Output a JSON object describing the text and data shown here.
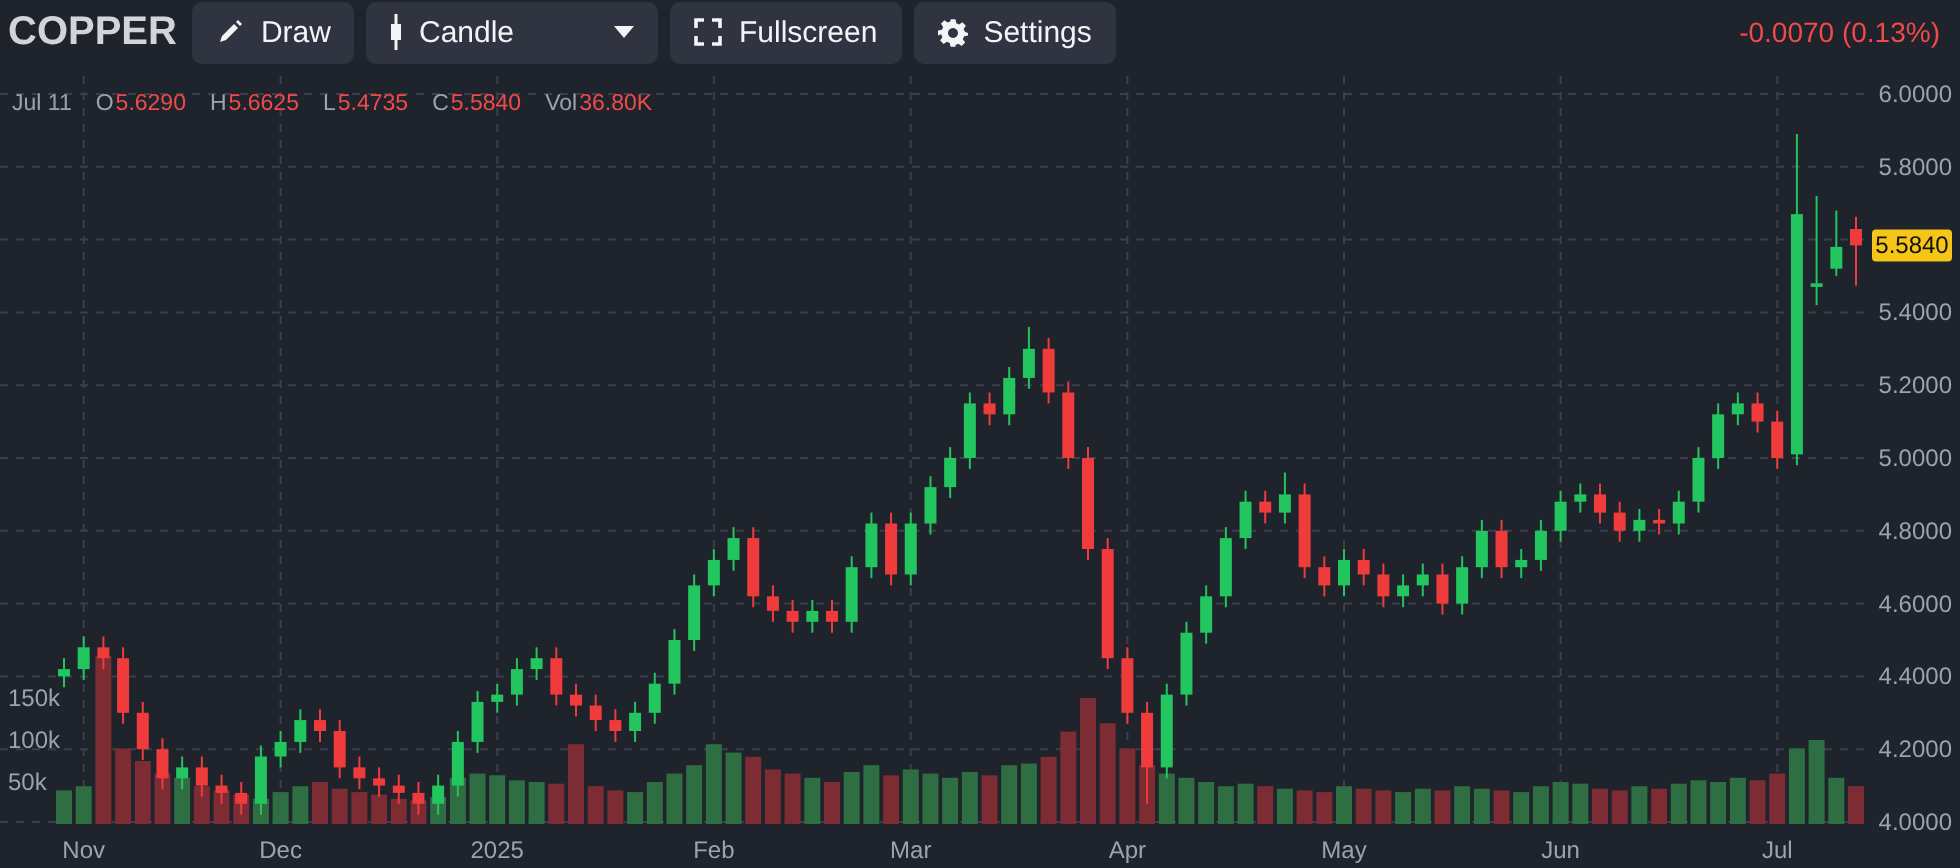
{
  "symbol": "COPPER",
  "toolbar": [
    {
      "kind": "draw",
      "label": "Draw"
    },
    {
      "kind": "dropdown",
      "label": "Candle"
    },
    {
      "kind": "fullscreen",
      "label": "Fullscreen"
    },
    {
      "kind": "settings",
      "label": "Settings"
    }
  ],
  "change": "-0.0070 (0.13%)",
  "info": {
    "date": "Jul 11",
    "fields": [
      {
        "label": "O",
        "value": "5.6290"
      },
      {
        "label": "H",
        "value": "5.6625"
      },
      {
        "label": "L",
        "value": "5.4735"
      },
      {
        "label": "C",
        "value": "5.5840"
      },
      {
        "label": "Vol",
        "value": "36.80K"
      }
    ]
  },
  "last_price": "5.5840",
  "price_chart": {
    "chart_data": {
      "type": "candlestick",
      "ylim": [
        4.0,
        6.0
      ],
      "yticks": [
        {
          "value": 4.0,
          "label": "4.0000"
        },
        {
          "value": 4.2,
          "label": "4.2000"
        },
        {
          "value": 4.4,
          "label": "4.4000"
        },
        {
          "value": 4.6,
          "label": "4.6000"
        },
        {
          "value": 4.8,
          "label": "4.8000"
        },
        {
          "value": 5.0,
          "label": "5.0000"
        },
        {
          "value": 5.2,
          "label": "5.2000"
        },
        {
          "value": 5.4,
          "label": "5.4000"
        },
        {
          "value": 5.8,
          "label": "5.8000"
        },
        {
          "value": 6.0,
          "label": "6.0000"
        }
      ],
      "categories": [
        null,
        "Nov",
        null,
        null,
        null,
        null,
        null,
        null,
        null,
        null,
        null,
        "Dec",
        null,
        null,
        null,
        null,
        null,
        null,
        null,
        null,
        null,
        null,
        "2025",
        null,
        null,
        null,
        null,
        null,
        null,
        null,
        null,
        null,
        null,
        "Feb",
        null,
        null,
        null,
        null,
        null,
        null,
        null,
        null,
        null,
        "Mar",
        null,
        null,
        null,
        null,
        null,
        null,
        null,
        null,
        null,
        null,
        "Apr",
        null,
        null,
        null,
        null,
        null,
        null,
        null,
        null,
        null,
        null,
        "May",
        null,
        null,
        null,
        null,
        null,
        null,
        null,
        null,
        null,
        null,
        "Jun",
        null,
        null,
        null,
        null,
        null,
        null,
        null,
        null,
        null,
        null,
        "Jul",
        null,
        null,
        null,
        null
      ],
      "ohlc": [
        [
          4.4,
          4.45,
          4.37,
          4.42
        ],
        [
          4.42,
          4.51,
          4.39,
          4.48
        ],
        [
          4.48,
          4.51,
          4.42,
          4.45
        ],
        [
          4.45,
          4.48,
          4.27,
          4.3
        ],
        [
          4.3,
          4.33,
          4.17,
          4.2
        ],
        [
          4.2,
          4.23,
          4.09,
          4.12
        ],
        [
          4.12,
          4.18,
          4.09,
          4.15
        ],
        [
          4.15,
          4.18,
          4.07,
          4.1
        ],
        [
          4.1,
          4.13,
          4.05,
          4.08
        ],
        [
          4.08,
          4.11,
          4.02,
          4.05
        ],
        [
          4.05,
          4.21,
          4.02,
          4.18
        ],
        [
          4.18,
          4.25,
          4.15,
          4.22
        ],
        [
          4.22,
          4.31,
          4.19,
          4.28
        ],
        [
          4.28,
          4.31,
          4.22,
          4.25
        ],
        [
          4.25,
          4.28,
          4.12,
          4.15
        ],
        [
          4.15,
          4.18,
          4.09,
          4.12
        ],
        [
          4.12,
          4.15,
          4.07,
          4.1
        ],
        [
          4.1,
          4.13,
          4.05,
          4.08
        ],
        [
          4.08,
          4.11,
          4.02,
          4.05
        ],
        [
          4.05,
          4.13,
          4.02,
          4.1
        ],
        [
          4.1,
          4.25,
          4.07,
          4.22
        ],
        [
          4.22,
          4.36,
          4.19,
          4.33
        ],
        [
          4.33,
          4.38,
          4.3,
          4.35
        ],
        [
          4.35,
          4.45,
          4.32,
          4.42
        ],
        [
          4.42,
          4.48,
          4.39,
          4.45
        ],
        [
          4.45,
          4.48,
          4.32,
          4.35
        ],
        [
          4.35,
          4.38,
          4.29,
          4.32
        ],
        [
          4.32,
          4.35,
          4.25,
          4.28
        ],
        [
          4.28,
          4.31,
          4.22,
          4.25
        ],
        [
          4.25,
          4.33,
          4.22,
          4.3
        ],
        [
          4.3,
          4.41,
          4.27,
          4.38
        ],
        [
          4.38,
          4.53,
          4.35,
          4.5
        ],
        [
          4.5,
          4.68,
          4.47,
          4.65
        ],
        [
          4.65,
          4.75,
          4.62,
          4.72
        ],
        [
          4.72,
          4.81,
          4.69,
          4.78
        ],
        [
          4.78,
          4.81,
          4.59,
          4.62
        ],
        [
          4.62,
          4.65,
          4.55,
          4.58
        ],
        [
          4.58,
          4.61,
          4.52,
          4.55
        ],
        [
          4.55,
          4.61,
          4.52,
          4.58
        ],
        [
          4.58,
          4.61,
          4.52,
          4.55
        ],
        [
          4.55,
          4.73,
          4.52,
          4.7
        ],
        [
          4.7,
          4.85,
          4.67,
          4.82
        ],
        [
          4.82,
          4.85,
          4.65,
          4.68
        ],
        [
          4.68,
          4.85,
          4.65,
          4.82
        ],
        [
          4.82,
          4.95,
          4.79,
          4.92
        ],
        [
          4.92,
          5.03,
          4.89,
          5.0
        ],
        [
          5.0,
          5.18,
          4.97,
          5.15
        ],
        [
          5.15,
          5.18,
          5.09,
          5.12
        ],
        [
          5.12,
          5.25,
          5.09,
          5.22
        ],
        [
          5.22,
          5.36,
          5.19,
          5.3
        ],
        [
          5.3,
          5.33,
          5.15,
          5.18
        ],
        [
          5.18,
          5.21,
          4.97,
          5.0
        ],
        [
          5.0,
          5.03,
          4.72,
          4.75
        ],
        [
          4.75,
          4.78,
          4.42,
          4.45
        ],
        [
          4.45,
          4.48,
          4.27,
          4.3
        ],
        [
          4.3,
          4.33,
          4.05,
          4.15
        ],
        [
          4.15,
          4.38,
          4.12,
          4.35
        ],
        [
          4.35,
          4.55,
          4.32,
          4.52
        ],
        [
          4.52,
          4.65,
          4.49,
          4.62
        ],
        [
          4.62,
          4.81,
          4.59,
          4.78
        ],
        [
          4.78,
          4.91,
          4.75,
          4.88
        ],
        [
          4.88,
          4.91,
          4.82,
          4.85
        ],
        [
          4.85,
          4.96,
          4.82,
          4.9
        ],
        [
          4.9,
          4.93,
          4.67,
          4.7
        ],
        [
          4.7,
          4.73,
          4.62,
          4.65
        ],
        [
          4.65,
          4.75,
          4.62,
          4.72
        ],
        [
          4.72,
          4.75,
          4.65,
          4.68
        ],
        [
          4.68,
          4.71,
          4.59,
          4.62
        ],
        [
          4.62,
          4.68,
          4.59,
          4.65
        ],
        [
          4.65,
          4.71,
          4.62,
          4.68
        ],
        [
          4.68,
          4.71,
          4.57,
          4.6
        ],
        [
          4.6,
          4.73,
          4.57,
          4.7
        ],
        [
          4.7,
          4.83,
          4.67,
          4.8
        ],
        [
          4.8,
          4.83,
          4.67,
          4.7
        ],
        [
          4.7,
          4.75,
          4.67,
          4.72
        ],
        [
          4.72,
          4.83,
          4.69,
          4.8
        ],
        [
          4.8,
          4.91,
          4.77,
          4.88
        ],
        [
          4.88,
          4.93,
          4.85,
          4.9
        ],
        [
          4.9,
          4.93,
          4.82,
          4.85
        ],
        [
          4.85,
          4.88,
          4.77,
          4.8
        ],
        [
          4.8,
          4.86,
          4.77,
          4.83
        ],
        [
          4.83,
          4.86,
          4.79,
          4.82
        ],
        [
          4.82,
          4.91,
          4.79,
          4.88
        ],
        [
          4.88,
          5.03,
          4.85,
          5.0
        ],
        [
          5.0,
          5.15,
          4.97,
          5.12
        ],
        [
          5.12,
          5.18,
          5.09,
          5.15
        ],
        [
          5.15,
          5.18,
          5.07,
          5.1
        ],
        [
          5.1,
          5.13,
          4.97,
          5.0
        ],
        [
          5.01,
          5.89,
          4.98,
          5.67
        ],
        [
          5.47,
          5.72,
          5.42,
          5.48
        ],
        [
          5.52,
          5.68,
          5.5,
          5.58
        ],
        [
          5.629,
          5.6625,
          5.4735,
          5.584
        ]
      ]
    }
  },
  "volume_chart": {
    "chart_data": {
      "type": "bar",
      "ylim": [
        0,
        200
      ],
      "yticks": [
        {
          "value": 50,
          "label": "50k"
        },
        {
          "value": 100,
          "label": "100k"
        },
        {
          "value": 150,
          "label": "150k"
        }
      ],
      "categories": [
        null,
        null,
        null,
        null,
        null,
        null,
        null,
        null,
        null,
        null,
        null,
        null,
        null,
        null,
        null,
        null,
        null,
        null,
        null,
        null,
        null,
        null,
        null,
        null,
        null,
        null,
        null,
        null,
        null,
        null,
        null,
        null,
        null,
        null,
        null,
        null,
        null,
        null,
        null,
        null,
        null,
        null,
        null,
        null,
        null,
        null,
        null,
        null,
        null,
        null,
        null,
        null,
        null,
        null,
        null,
        null,
        null,
        null,
        null,
        null,
        null,
        null,
        null,
        null,
        null,
        null,
        null,
        null,
        null,
        null,
        null,
        null,
        null,
        null,
        null,
        null,
        null,
        null,
        null,
        null,
        null,
        null,
        null,
        null,
        null,
        null,
        null,
        null,
        null,
        null,
        null,
        null
      ],
      "values": [
        40,
        45,
        200,
        90,
        75,
        60,
        55,
        45,
        40,
        35,
        30,
        38,
        45,
        50,
        42,
        38,
        35,
        30,
        28,
        32,
        55,
        60,
        58,
        52,
        50,
        48,
        95,
        45,
        40,
        38,
        50,
        60,
        70,
        95,
        85,
        80,
        65,
        60,
        55,
        50,
        62,
        70,
        58,
        65,
        60,
        55,
        62,
        58,
        70,
        72,
        80,
        110,
        150,
        120,
        90,
        70,
        60,
        55,
        50,
        45,
        48,
        45,
        42,
        40,
        38,
        45,
        42,
        40,
        38,
        42,
        40,
        45,
        42,
        40,
        38,
        45,
        50,
        48,
        42,
        40,
        45,
        42,
        48,
        52,
        50,
        55,
        52,
        60,
        90,
        100,
        55,
        45
      ]
    }
  }
}
